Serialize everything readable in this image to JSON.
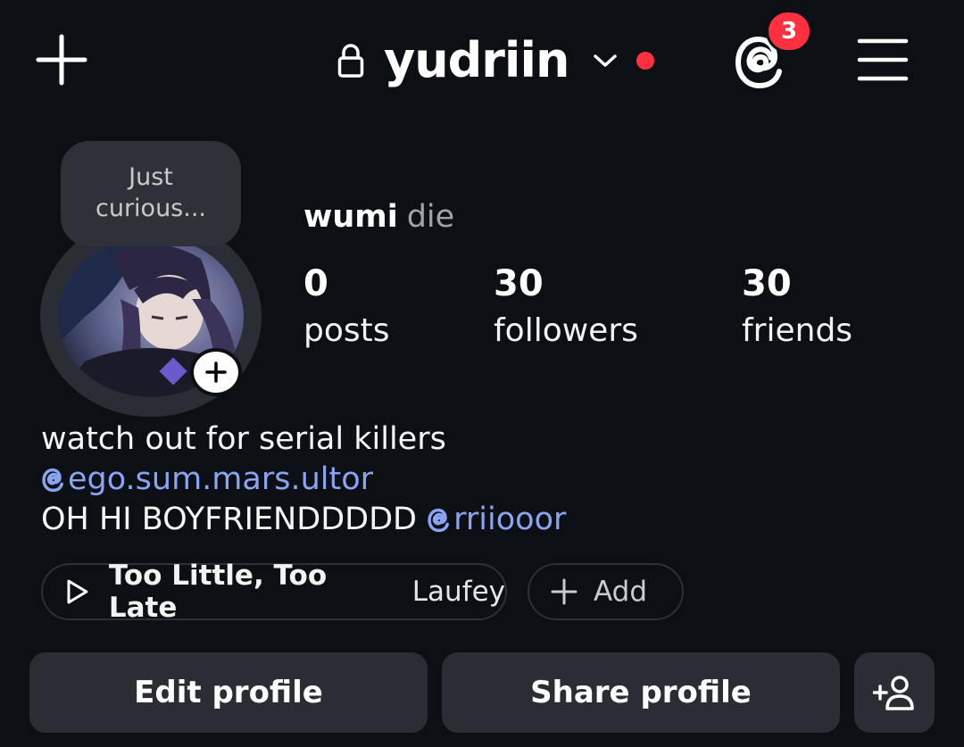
{
  "header": {
    "username": "yudriin",
    "notification_count": "3",
    "accent_color": "#ff3040",
    "icons": [
      "plus-icon",
      "lock-icon",
      "chevron-down-icon",
      "threads-icon",
      "hamburger-menu-icon"
    ]
  },
  "profile": {
    "note": [
      "Just",
      "curious..."
    ],
    "name": "wumi",
    "pronouns": "die"
  },
  "stats": [
    {
      "value": "0",
      "label": "posts"
    },
    {
      "value": "30",
      "label": "followers"
    },
    {
      "value": "30",
      "label": "friends"
    }
  ],
  "bio": {
    "line1": "watch out for serial killers",
    "line2_mention": "ego.sum.mars.ultor",
    "line3_text": "OH HI BOYFRIENDDDDD",
    "line3_mention": "rriiooor",
    "mention_color": "#8aa4f2"
  },
  "music": {
    "title": "Too Little, Too Late",
    "artist": "Laufey",
    "add_label": "Add"
  },
  "actions": {
    "edit_label": "Edit profile",
    "share_label": "Share profile"
  }
}
